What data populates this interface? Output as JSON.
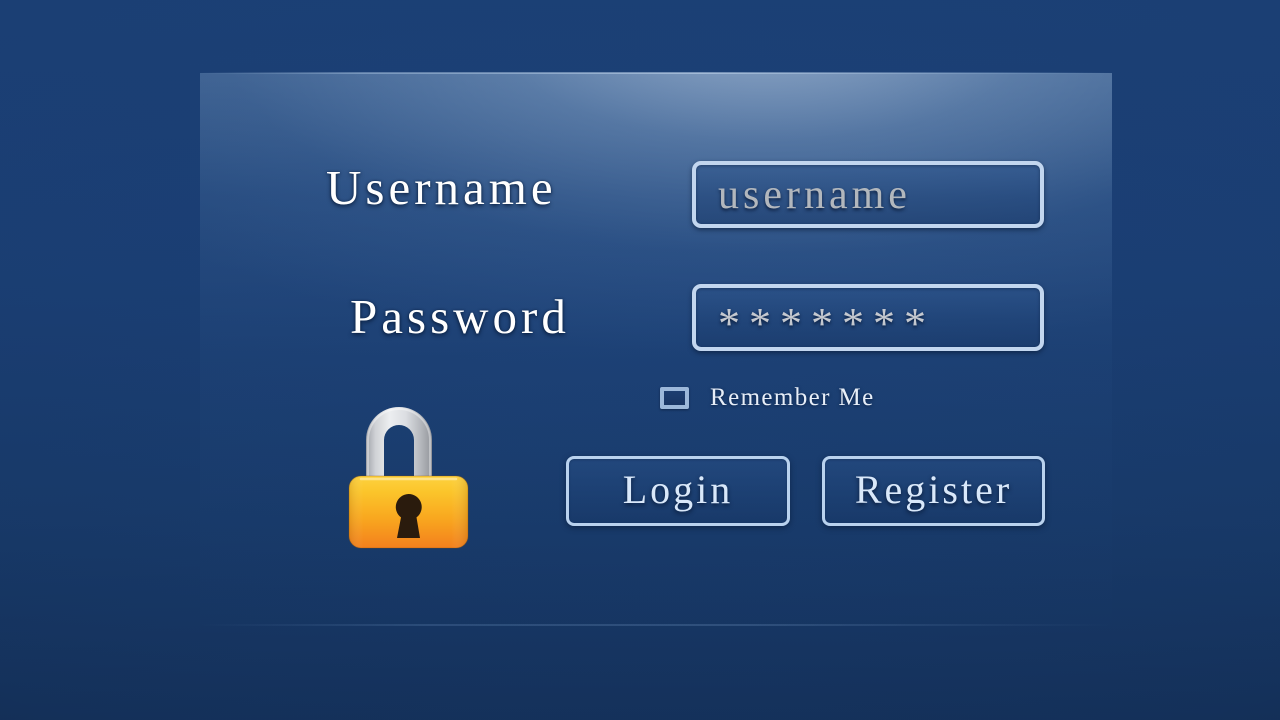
{
  "screen": {
    "title": "Login",
    "background_color": "#1a3d71",
    "panel_color": "#35699f"
  },
  "form": {
    "username": {
      "label": "Username",
      "placeholder": "username",
      "value": ""
    },
    "password": {
      "label": "Password",
      "placeholder": "",
      "value": "*******",
      "masked": true
    },
    "remember": {
      "label": "Remember Me",
      "checked": false
    }
  },
  "buttons": {
    "login": "Login",
    "register": "Register"
  },
  "icons": {
    "padlock": "lock-icon",
    "padlock_body_top_color": "#fbc52b",
    "padlock_body_bottom_color": "#f4801f",
    "padlock_shackle_color": "#d9dade",
    "padlock_keyhole_color": "#2a1b0d"
  },
  "colors": {
    "input_border": "#c2d6ef",
    "button_border": "#b9d2ee",
    "label_text": "#ffffff",
    "placeholder_text": "#b2b7bd",
    "button_text": "#d9e8fa"
  }
}
